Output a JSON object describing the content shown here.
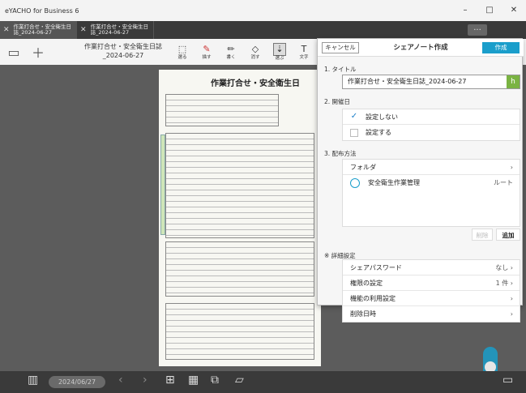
{
  "window": {
    "title": "eYACHO for Business 6",
    "controls": [
      "–",
      "□",
      "✕"
    ]
  },
  "tabs": [
    {
      "line1": "作業打合せ・安全衛生日",
      "line2": "誌_2024-06-27",
      "active": true
    },
    {
      "line1": "作業打合せ・安全衛生日",
      "line2": "誌_2024-06-27",
      "active": false
    }
  ],
  "more_label": "...",
  "toolbar": {
    "doc_title_line1": "作業打合せ・安全衛生日誌",
    "doc_title_line2": "_2024-06-27",
    "tools": [
      {
        "icon": "select-icon",
        "label": "選る"
      },
      {
        "icon": "pen-icon",
        "label": "描す"
      },
      {
        "icon": "write-icon",
        "label": "書く"
      },
      {
        "icon": "eraser-icon",
        "label": "消す"
      },
      {
        "icon": "select-area-icon",
        "label": "選ぶ"
      },
      {
        "icon": "text-icon",
        "label": "文字"
      }
    ]
  },
  "page": {
    "heading": "作業打合せ・安全衛生日"
  },
  "bottombar": {
    "date": "2024/06/27"
  },
  "panel": {
    "cancel_label": "キャンセル",
    "title": "シェアノート作成",
    "create_label": "作成",
    "sections": {
      "title_label": "1. タイトル",
      "title_value": "作業打合せ・安全衛生日誌_2024-06-27",
      "date_label": "2. 開催日",
      "date_options": [
        {
          "label": "設定しない",
          "checked": true
        },
        {
          "label": "設定する",
          "checked": false
        }
      ],
      "dist_label": "3. 配布方法",
      "folder_label": "フォルダ",
      "folder_item": "安全衛生作業管理",
      "folder_item_right": "ルート",
      "delete_label": "削除",
      "add_label": "追加",
      "detail_label": "※ 詳細設定",
      "details": [
        {
          "label": "シェアパスワード",
          "value": "なし"
        },
        {
          "label": "権限の設定",
          "value": "1 件"
        },
        {
          "label": "機能の利用設定",
          "value": ""
        },
        {
          "label": "削除日時",
          "value": ""
        }
      ]
    }
  },
  "colors": {
    "accent": "#1a9ecb",
    "chrome": "#3a3a3a",
    "canvas": "#5c5c5c"
  }
}
